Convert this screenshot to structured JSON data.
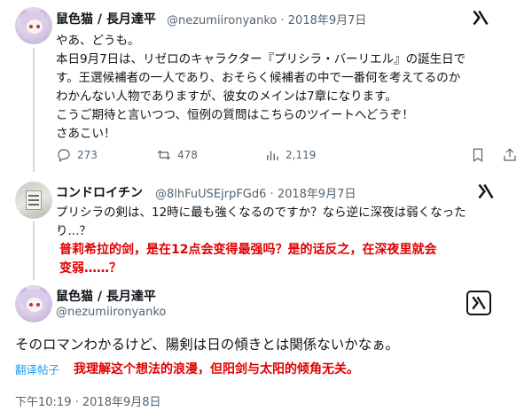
{
  "tweet1": {
    "display_name": "鼠色猫 / 長月達平",
    "handle": "@nezumiironyanko",
    "separator": "·",
    "date": "2018年9月7日",
    "lines": [
      "やあ、どうも。",
      "本日9月7日は、リゼロのキャラクター『プリシラ・バーリエル』の誕生日です。王選候補者の一人であり、おそらく候補者の中で一番何を考えてるのか",
      "わかんない人物でありますが、彼女のメインは7章になります。",
      "こうご期待と言いつつ、恒例の質問はこちらのツイートへどうぞ！",
      "さあこい！"
    ],
    "line1b": "本日9月7日は、リゼロのキャラクター『プリシラ・バーリエル』の誕生日で",
    "line1c": "す。王選候補者の一人であり、おそらく候補者の中で一番何を考えてるのか",
    "actions": {
      "replies": "273",
      "retweets": "478",
      "views": "2,119"
    }
  },
  "tweet2": {
    "display_name": "コンドロイチン",
    "handle": "@8lhFuUSEjrpFGd6",
    "separator": "·",
    "date": "2018年9月7日",
    "line_a": "プリシラの剣は、12時に最も強くなるのですか？なら逆に深夜は弱くなった",
    "line_b": "り...？",
    "translation_a": "普莉希拉的剑，是在12点会变得最强吗？是的话反之，在深夜里就会",
    "translation_b": "变弱……？"
  },
  "tweet3": {
    "display_name": "鼠色猫 / 長月達平",
    "handle": "@nezumiironyanko",
    "text": "そのロマンわかるけど、陽剣は日の傾きとは関係ないかなぁ。",
    "translate_label": "翻译帖子",
    "translation": "我理解这个想法的浪漫，但阳剑与太阳的倾角无关。",
    "time": "下午10:19",
    "separator": "·",
    "date": "2018年9月8日"
  },
  "icons": [
    "x-logo-icon",
    "reply-icon",
    "retweet-icon",
    "views-icon",
    "bookmark-icon",
    "share-icon"
  ],
  "colors": {
    "translation": "#e00000",
    "link": "#1d9bf0",
    "muted": "#536471"
  }
}
